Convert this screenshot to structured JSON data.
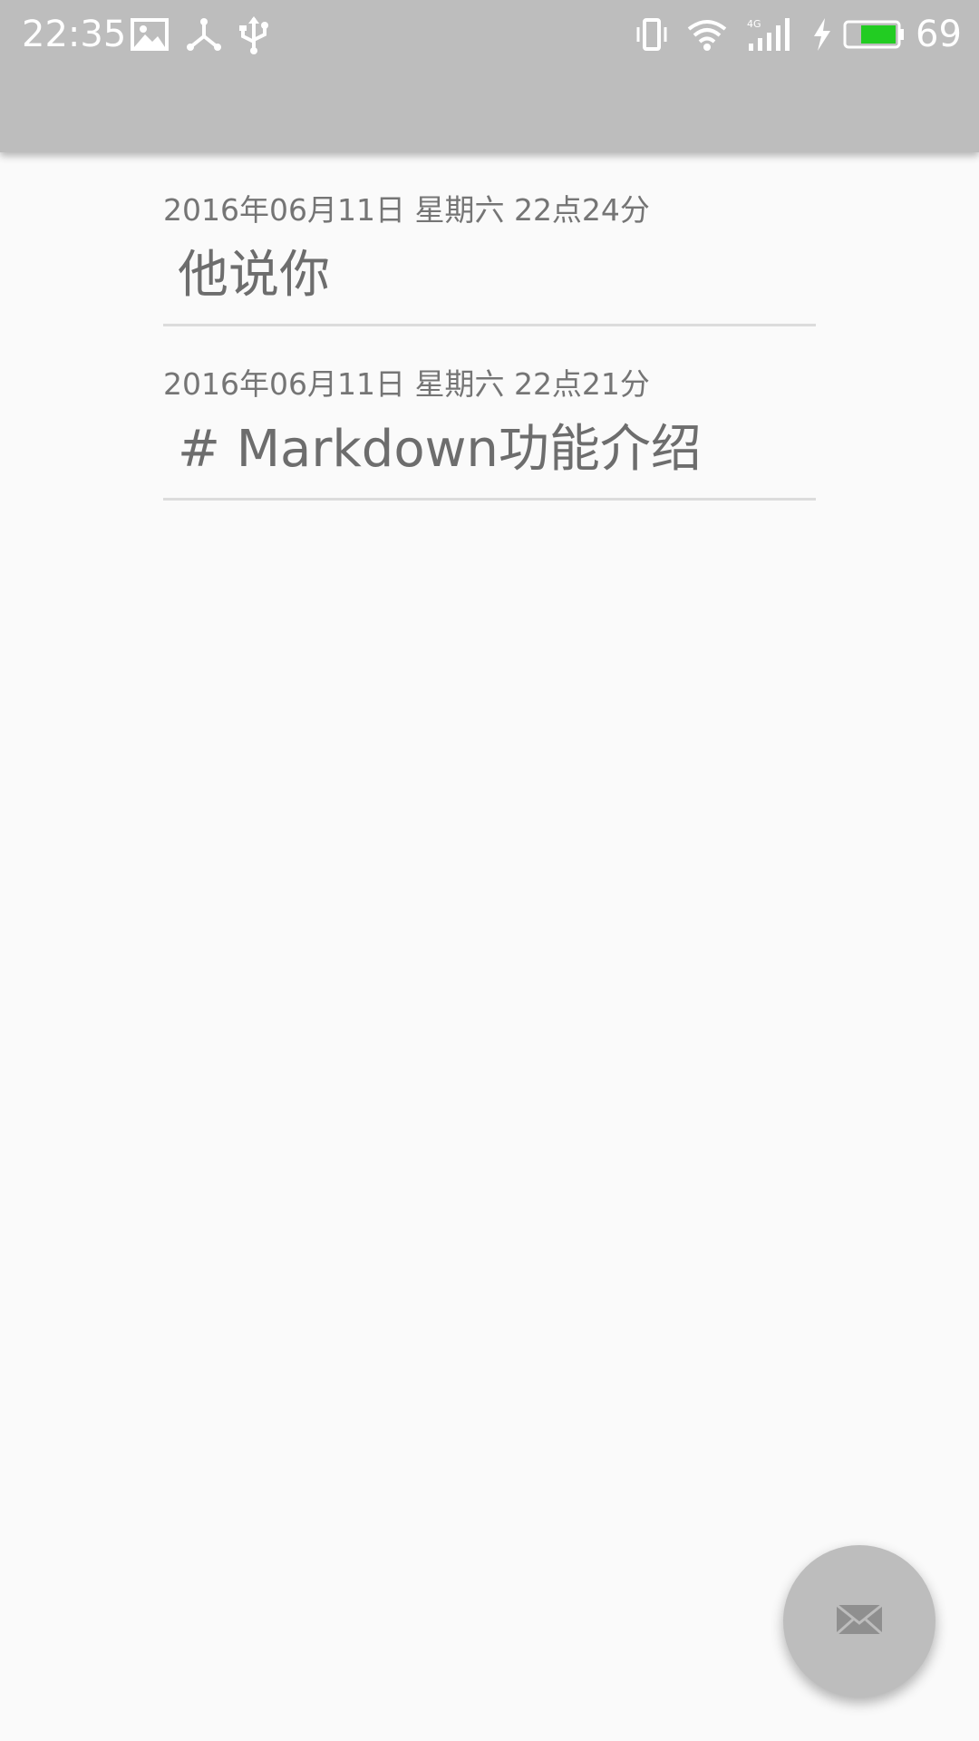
{
  "status_bar": {
    "time": "22:35",
    "battery_percent": "69",
    "network_type": "4G",
    "icons": [
      "image-icon",
      "share-icon",
      "usb-icon",
      "vibrate-icon",
      "wifi-icon",
      "signal-icon",
      "charging-icon",
      "battery-icon"
    ],
    "battery_color": "#22cc22"
  },
  "toolbar": {
    "background": "#bdbdbd"
  },
  "notes": [
    {
      "date": "2016年06月11日 星期六 22点24分",
      "title": "他说你"
    },
    {
      "date": "2016年06月11日 星期六 22点21分",
      "title": "# Markdown功能介绍"
    }
  ],
  "fab": {
    "icon": "mail-icon",
    "background": "#bdbdbd"
  }
}
